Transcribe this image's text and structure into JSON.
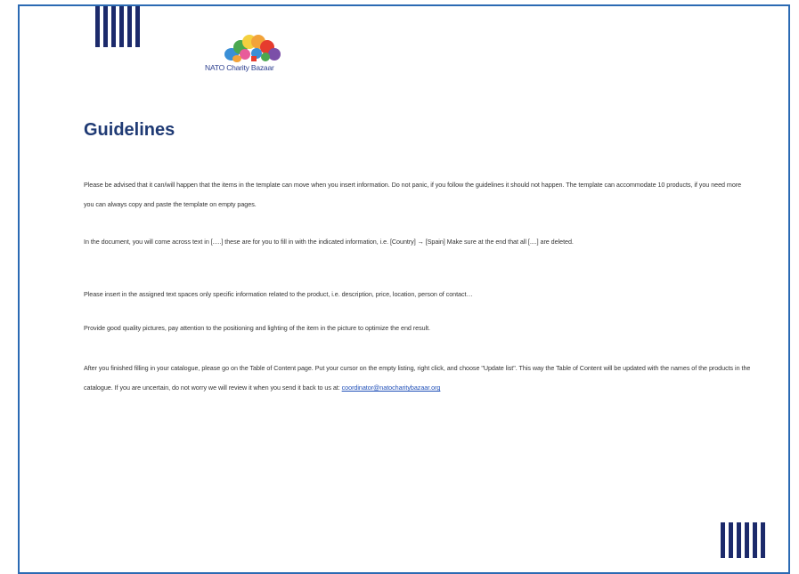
{
  "logo": {
    "name": "NATO Charity Bazaar",
    "colors": [
      "#e63b2e",
      "#f2a33a",
      "#f4d03f",
      "#4aa84f",
      "#3a8fd6",
      "#7b4fa8",
      "#e85c9a"
    ]
  },
  "heading": "Guidelines",
  "paragraphs": {
    "p1": "Please be advised that it can/will happen that the items in the template can move when you insert information.  Do not panic, if you follow the guidelines it should not happen.  The template can accommodate 10 products, if you need more you can always copy and paste the template on empty pages.",
    "p2": "In the document, you will come across text in [.....] these are for you to fill in with the indicated information, i.e. [Country] → [Spain]  Make sure at the end that all [....] are deleted.",
    "p3": "Please insert in the assigned text spaces only specific information related to the product, i.e. description, price, location, person of contact…",
    "p4": "Provide good quality pictures, pay attention to the positioning and lighting of the item in the picture to optimize the end result.",
    "p5_text": "After you finished filling in your catalogue, please go on the Table of Content page.  Put your cursor on the empty listing, right click, and choose \"Update list\". This way the Table of Content will be updated with the names of the products in the catalogue.  If you are uncertain, do not worry we will review it when you send it back to us at: ",
    "p5_email": "coordinator@natocharitybazaar.org"
  },
  "colors": {
    "border": "#2b6ab3",
    "bars": "#1c2a6b",
    "heading": "#1f3a74"
  }
}
